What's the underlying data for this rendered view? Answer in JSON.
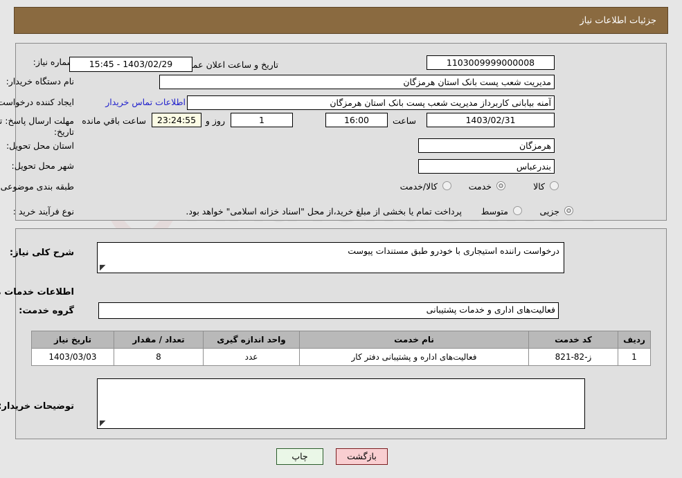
{
  "header": {
    "title": "جزئیات اطلاعات نیاز"
  },
  "form": {
    "labels": {
      "need_number": "شماره نیاز:",
      "buyer_org": "نام دستگاه خریدار:",
      "request_creator": "ایجاد کننده درخواست:",
      "response_deadline_line1": "مهلت ارسال پاسخ: تا",
      "response_deadline_line2": "تاریخ:",
      "public_announce_datetime": "تاریخ و ساعت اعلان عمومی:",
      "delivery_province": "استان محل تحویل:",
      "delivery_city": "شهر محل تحویل:",
      "subject_category": "طبقه بندی موضوعی:",
      "purchase_process_type": "نوع فرآیند خرید :",
      "hour": "ساعت",
      "day_and": "روز و",
      "hours_remaining": "ساعت باقي مانده"
    },
    "values": {
      "need_number": "1103009999000008",
      "buyer_org": "مدیریت شعب پست بانک استان هرمزگان",
      "request_creator": "آمنه بیابانی کاربرداز مدیریت شعب پست بانک استان هرمزگان",
      "deadline_date": "1403/02/31",
      "deadline_hour": "16:00",
      "remaining_days": "1",
      "remaining_time": "23:24:55",
      "public_announce_datetime": "1403/02/29 - 15:45",
      "delivery_province": "هرمزگان",
      "delivery_city": "بندرعباس"
    },
    "links": {
      "buyer_contact": "اطلاعات تماس خریدار"
    },
    "subject_category_options": [
      {
        "label": "کالا",
        "selected": false
      },
      {
        "label": "خدمت",
        "selected": true
      },
      {
        "label": "کالا/خدمت",
        "selected": false
      }
    ],
    "purchase_process_options": [
      {
        "label": "جزیی",
        "selected": true
      },
      {
        "label": "متوسط",
        "selected": false
      }
    ],
    "purchase_note": "پرداخت تمام یا بخشی از مبلغ خرید،از محل \"اسناد خزانه اسلامی\" خواهد بود."
  },
  "details": {
    "need_summary_label": "شرح کلی نیاز:",
    "need_summary_value": "درخواست راننده استیجاری با خودرو طبق مستندات پیوست",
    "services_info_heading": "اطلاعات خدمات مورد نیاز",
    "service_group_label": "گروه خدمت:",
    "service_group_value": "فعالیت‌های اداری و خدمات پشتیبانی",
    "buyer_notes_label": "توضیحات خریدار:",
    "buyer_notes_value": ""
  },
  "table": {
    "headers": {
      "row": "ردیف",
      "service_code": "کد خدمت",
      "service_name": "نام خدمت",
      "unit": "واحد اندازه گیری",
      "quantity": "تعداد / مقدار",
      "need_date": "تاریخ نیاز"
    },
    "rows": [
      {
        "row": "1",
        "service_code": "ز-82-821",
        "service_name": "فعالیت‌های اداره و پشتیبانی دفتر کار",
        "unit": "عدد",
        "quantity": "8",
        "need_date": "1403/03/03"
      }
    ]
  },
  "footer": {
    "print_label": "چاپ",
    "back_label": "بازگشت"
  },
  "watermark": {
    "text": "AriaTender.net"
  },
  "colors": {
    "header_bg": "#8a6a40",
    "panel_bg": "#e0e0e0",
    "page_bg": "#e6e6e6",
    "link": "#2222cc",
    "back_button_bg": "#f9ced1",
    "print_button_bg": "#eaf7e7",
    "countdown_bg": "#fbfbe4",
    "table_header_bg": "#b9b9b9"
  }
}
